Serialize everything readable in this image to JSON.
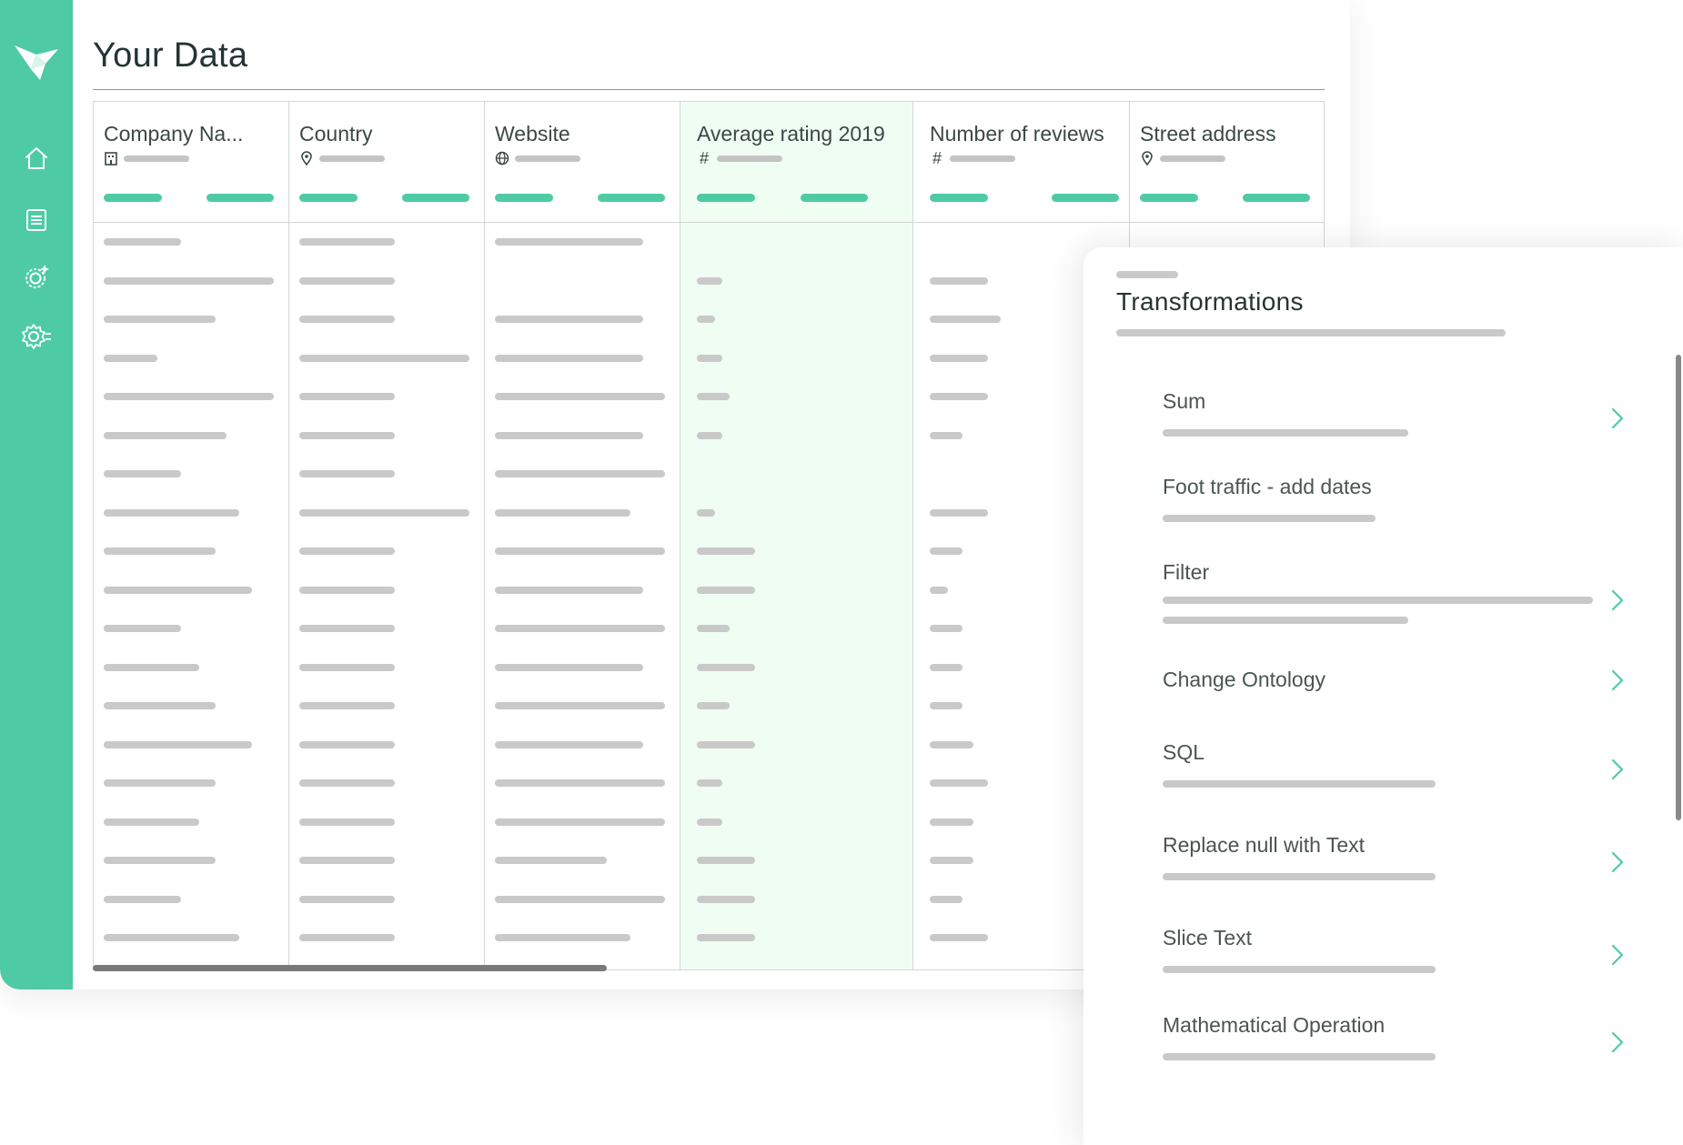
{
  "page": {
    "title": "Your Data"
  },
  "colors": {
    "brand": "#4ecba4",
    "highlight_column": "#f0fdf3",
    "placeholder": "#c9c9c9"
  },
  "sidebar": {
    "logo_icon": "origami-bird-logo",
    "items": [
      {
        "name": "home",
        "icon": "home-icon"
      },
      {
        "name": "data",
        "icon": "document-list-icon"
      },
      {
        "name": "integrations",
        "icon": "orbit-sparkle-icon"
      },
      {
        "name": "settings",
        "icon": "gear-icon"
      }
    ]
  },
  "table": {
    "columns": [
      {
        "label": "Company Na...",
        "type_icon": "building-icon",
        "highlighted": false
      },
      {
        "label": "Country",
        "type_icon": "location-pin-icon",
        "highlighted": false
      },
      {
        "label": "Website",
        "type_icon": "globe-icon",
        "highlighted": false
      },
      {
        "label": "Average rating 2019",
        "type_icon": "hash-icon",
        "type_symbol": "#",
        "highlighted": true
      },
      {
        "label": "Number of reviews",
        "type_icon": "hash-icon",
        "type_symbol": "#",
        "highlighted": false
      },
      {
        "label": "Street address",
        "type_icon": "location-pin-icon",
        "highlighted": false
      }
    ]
  },
  "transformations": {
    "title": "Transformations",
    "items": [
      {
        "label": "Sum"
      },
      {
        "label": "Foot traffic - add dates"
      },
      {
        "label": "Filter"
      },
      {
        "label": "Change Ontology"
      },
      {
        "label": "SQL"
      },
      {
        "label": "Replace null with Text"
      },
      {
        "label": "Slice Text"
      },
      {
        "label": "Mathematical Operation"
      }
    ]
  }
}
